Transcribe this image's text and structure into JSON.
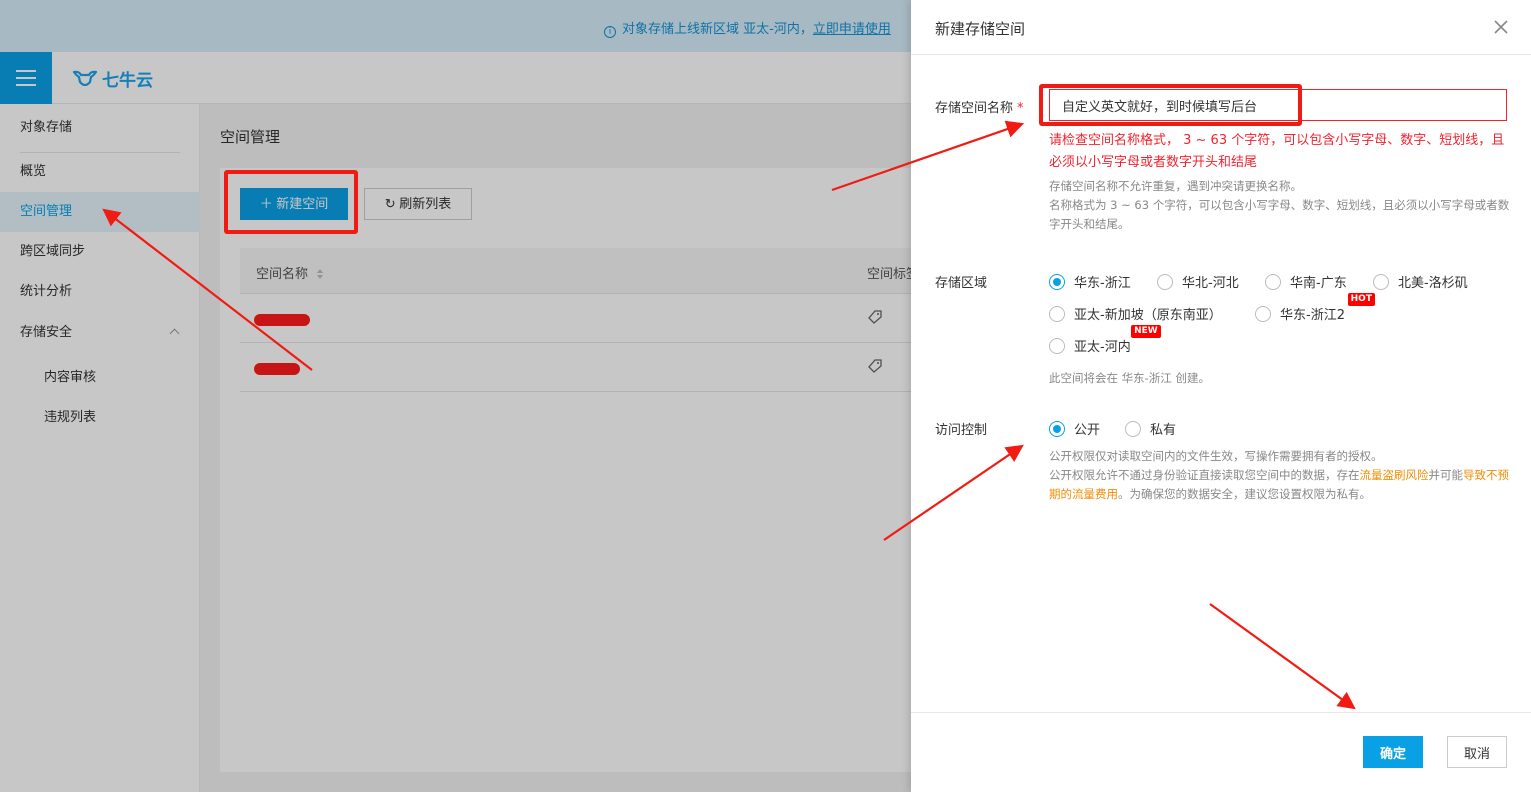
{
  "banner": {
    "info_icon": "i",
    "text": "对象存储上线新区域 亚太-河内，",
    "link": "立即申请使用"
  },
  "header": {
    "logo_text": "七牛云"
  },
  "sidebar": {
    "items": [
      {
        "label": "对象存储"
      },
      {
        "label": "概览"
      },
      {
        "label": "空间管理"
      },
      {
        "label": "跨区域同步"
      },
      {
        "label": "统计分析"
      },
      {
        "label": "存储安全"
      },
      {
        "label": "内容审核"
      },
      {
        "label": "违规列表"
      }
    ]
  },
  "main": {
    "title": "空间管理",
    "new_button": "＋ 新建空间",
    "refresh_button": "刷新列表",
    "refresh_icon": "↻",
    "table": {
      "col_name": "空间名称",
      "col_tag": "空间标签"
    }
  },
  "drawer": {
    "title": "新建存储空间",
    "name_label": "存储空间名称",
    "required_mark": "*",
    "name_value": "自定义英文就好，到时候填写后台",
    "error": "请检查空间名称格式， 3 ~ 63 个字符，可以包含小写字母、数字、短划线，且必须以小写字母或者数字开头和结尾",
    "help1": "存储空间名称不允许重复，遇到冲突请更换名称。",
    "help2": "名称格式为 3 ~ 63 个字符，可以包含小写字母、数字、短划线，且必须以小写字母或者数字开头和结尾。",
    "region_label": "存储区域",
    "regions": [
      {
        "label": "华东-浙江",
        "checked": true
      },
      {
        "label": "华北-河北"
      },
      {
        "label": "华南-广东"
      },
      {
        "label": "北美-洛杉矶"
      },
      {
        "label": "亚太-新加坡（原东南亚）"
      },
      {
        "label": "华东-浙江2",
        "badge": "HOT"
      },
      {
        "label": "亚太-河内",
        "badge": "NEW"
      }
    ],
    "region_note": "此空间将会在 华东-浙江 创建。",
    "access_label": "访问控制",
    "access_options": [
      {
        "label": "公开",
        "checked": true
      },
      {
        "label": "私有"
      }
    ],
    "access_help1": "公开权限仅对读取空间内的文件生效，写操作需要拥有者的授权。",
    "access_help2_a": "公开权限允许不通过身份验证直接读取您空间中的数据，存在",
    "access_help2_warn1": "流量盗刷风险",
    "access_help2_b": "并可能",
    "access_help2_warn2": "导致不预期的流量费用",
    "access_help2_c": "。为确保您的数据安全，建议您设置权限为私有。",
    "ok_button": "确定",
    "cancel_button": "取消"
  },
  "colors": {
    "accent": "#0aa0e6",
    "error": "#f5222d",
    "warning": "#f08c00",
    "annotation": "#f01c14"
  }
}
